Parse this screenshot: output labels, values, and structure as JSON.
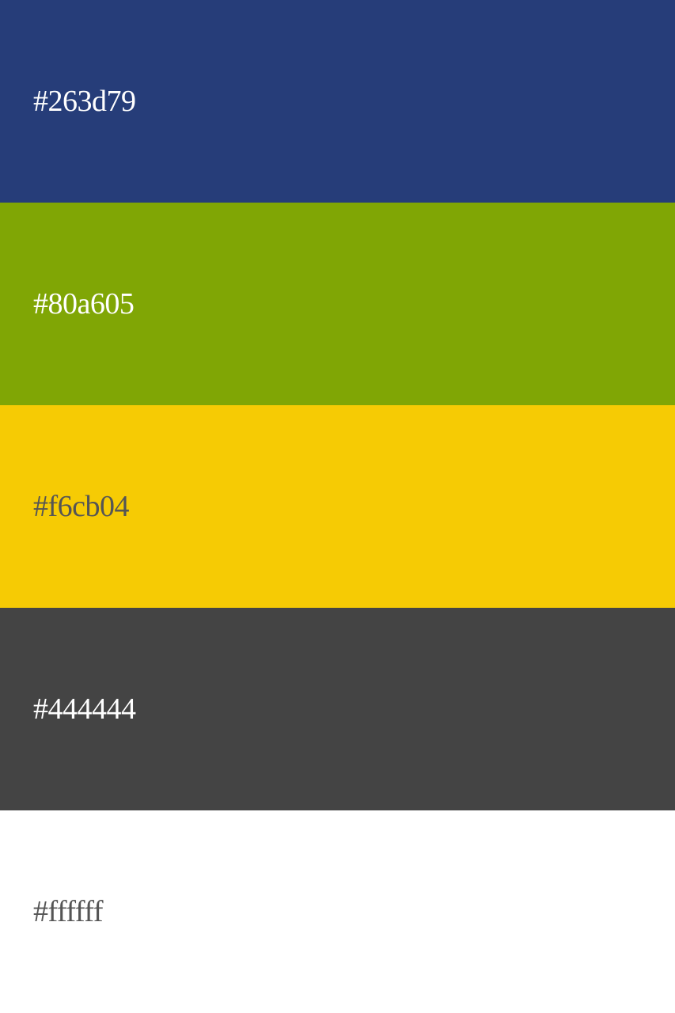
{
  "swatches": [
    {
      "label": "#263d79",
      "color": "#263d79",
      "text_color": "#ffffff"
    },
    {
      "label": "#80a605",
      "color": "#80a605",
      "text_color": "#ffffff"
    },
    {
      "label": "#f6cb04",
      "color": "#f6cb04",
      "text_color": "#555555"
    },
    {
      "label": "#444444",
      "color": "#444444",
      "text_color": "#ffffff"
    },
    {
      "label": "#ffffff",
      "color": "#ffffff",
      "text_color": "#555555"
    }
  ]
}
